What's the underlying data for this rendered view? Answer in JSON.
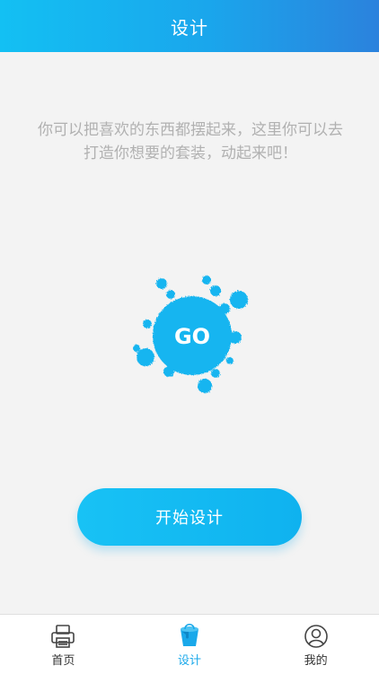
{
  "header": {
    "title": "设计"
  },
  "intro": {
    "text": "你可以把喜欢的东西都摆起来，这里你可以去打造你想要的套装，动起来吧！"
  },
  "splat": {
    "label": "GO",
    "color": "#19b5f0"
  },
  "start_button": {
    "label": "开始设计"
  },
  "tabbar": {
    "items": [
      {
        "label": "首页",
        "icon": "home-printer-icon",
        "active": false
      },
      {
        "label": "设计",
        "icon": "paint-bucket-icon",
        "active": true
      },
      {
        "label": "我的",
        "icon": "user-icon",
        "active": false
      }
    ]
  },
  "colors": {
    "accent": "#19a8ea",
    "header_start": "#13c0f3",
    "header_end": "#2b82dd"
  }
}
